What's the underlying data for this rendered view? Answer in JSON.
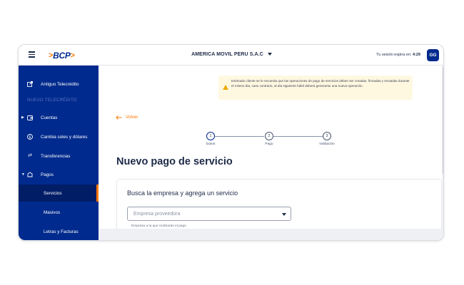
{
  "header": {
    "logo_text": "BCP",
    "company": "AMERICA MOVIL PERU S.A.C",
    "session_label": "Tu sesión expira en:",
    "session_time": "4:29",
    "avatar_initials": "GG"
  },
  "sidebar": {
    "old_app_label": "Antiguo Telecrédito",
    "section_label": "NUEVO TELECRÉDITO",
    "items": [
      {
        "label": "Cuentas"
      },
      {
        "label": "Cambia soles y dólares"
      },
      {
        "label": "Transferencias"
      },
      {
        "label": "Pagos"
      }
    ],
    "sub_items": [
      {
        "label": "Servicios",
        "active": true
      },
      {
        "label": "Masivos"
      },
      {
        "label": "Letras y Facturas"
      }
    ]
  },
  "alert": {
    "text": "Estimado cliente se le recuerda que las operaciones de pago de servicios deben ser creadas, firmadas y enviadas durante el mismo día, caso contrario, al día siguiente hábil deberá generarse una nueva operación."
  },
  "back_label": "Volver",
  "stepper": {
    "steps": [
      {
        "number": "1",
        "label": "Datos"
      },
      {
        "number": "2",
        "label": "Pago"
      },
      {
        "number": "3",
        "label": "Validación"
      }
    ]
  },
  "page_title": "Nuevo pago de servicio",
  "card": {
    "title": "Busca la empresa y agrega un servicio",
    "select_placeholder": "Empresa proveedora",
    "helper": "Empresa a la que realizarás el pago"
  },
  "colors": {
    "brand_blue": "#002a8d",
    "accent_orange": "#ff7800",
    "alert_bg": "#fff8e1"
  }
}
